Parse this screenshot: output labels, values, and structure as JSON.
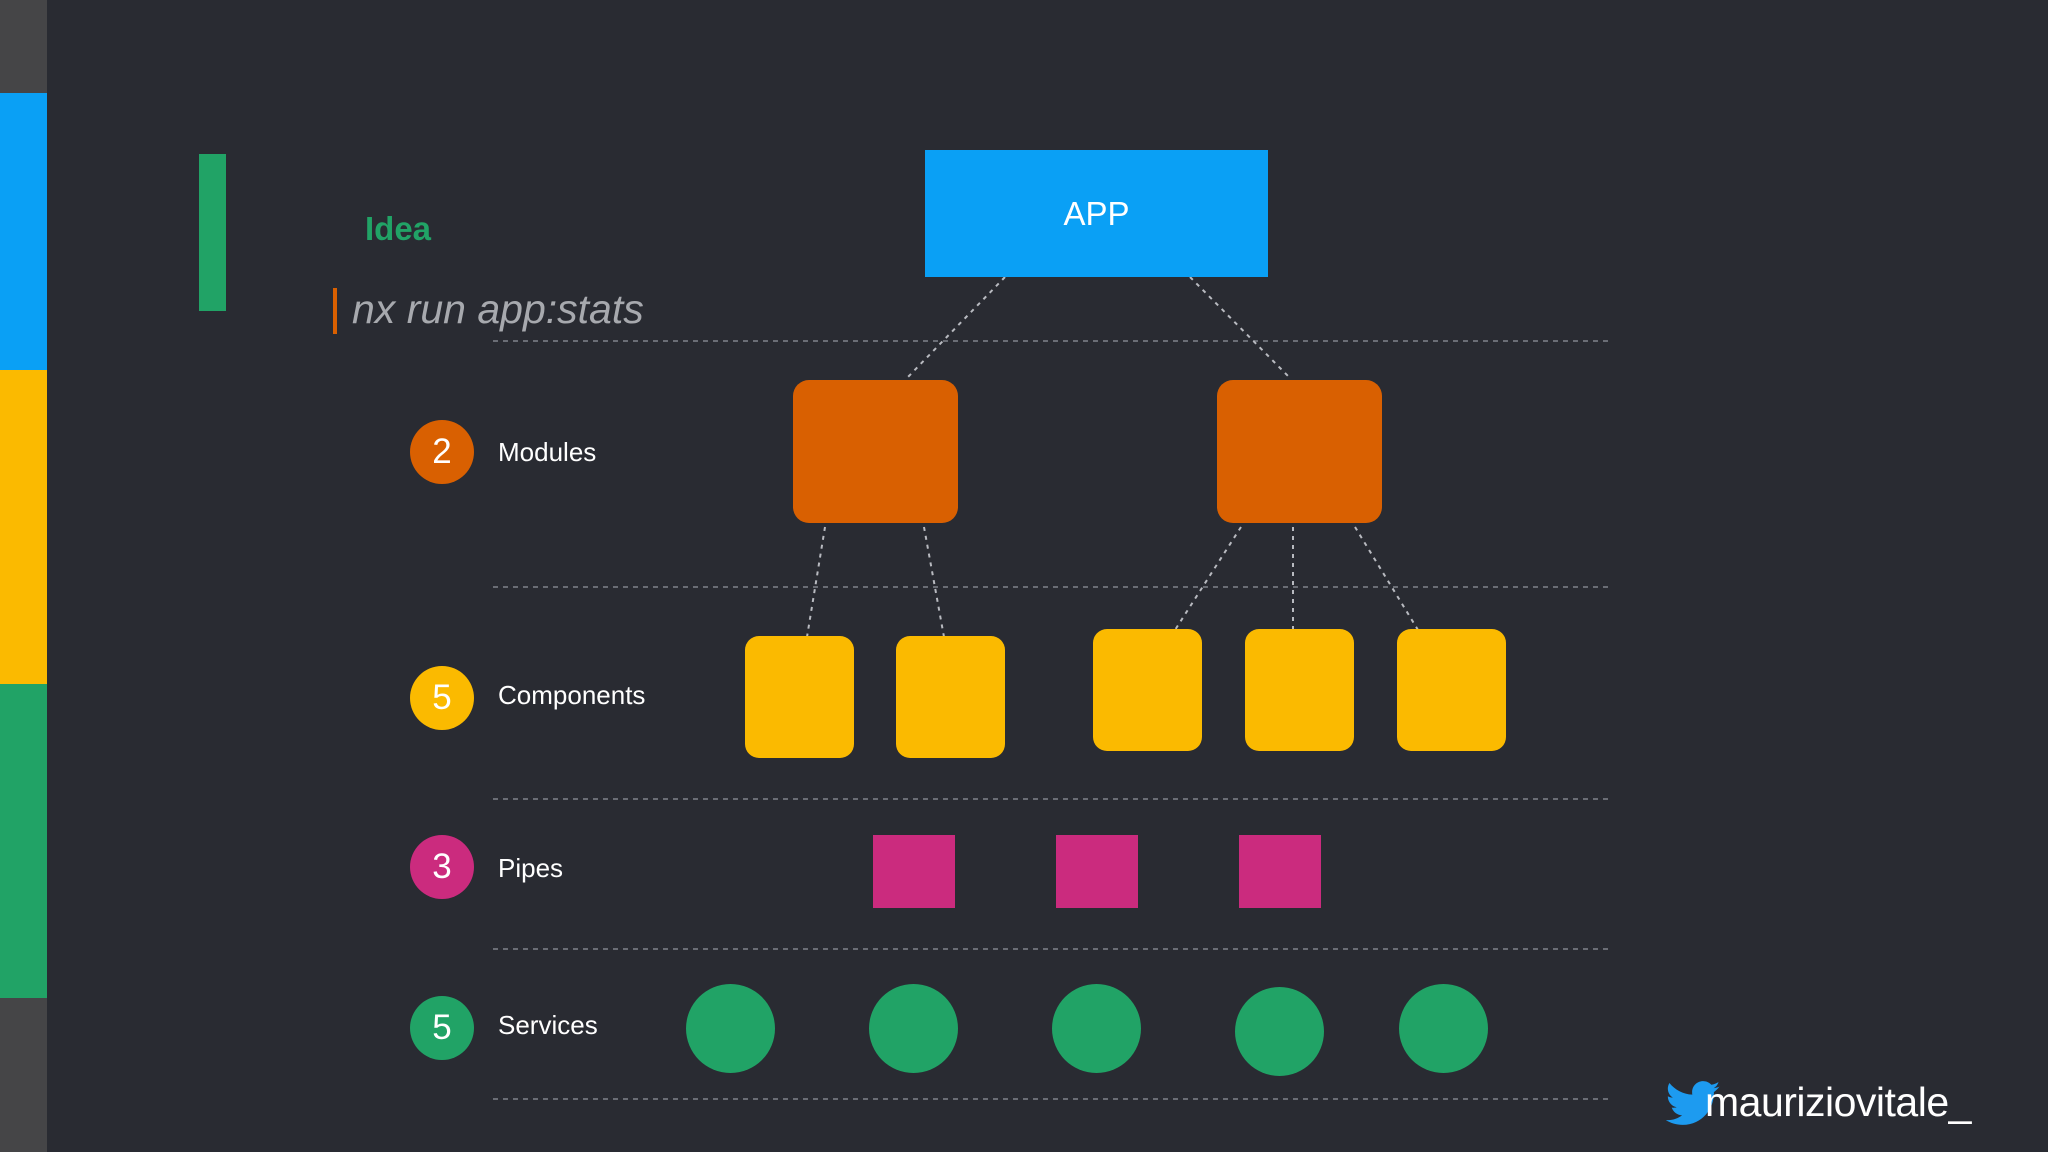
{
  "idea_label": "Idea",
  "command": "nx run app:stats",
  "app_label": "APP",
  "levels": [
    {
      "count": "2",
      "label": "Modules",
      "color": "#d96001"
    },
    {
      "count": "5",
      "label": "Components",
      "color": "#fbba00"
    },
    {
      "count": "3",
      "label": "Pipes",
      "color": "#cb2b7e"
    },
    {
      "count": "5",
      "label": "Services",
      "color": "#21a366"
    }
  ],
  "handle": "mauriziovitale_",
  "colors": {
    "background": "#292b32",
    "app": "#0aa0f5",
    "sidebar": [
      "#454547",
      "#0aa0f5",
      "#fbba00",
      "#21a366",
      "#454547"
    ]
  }
}
